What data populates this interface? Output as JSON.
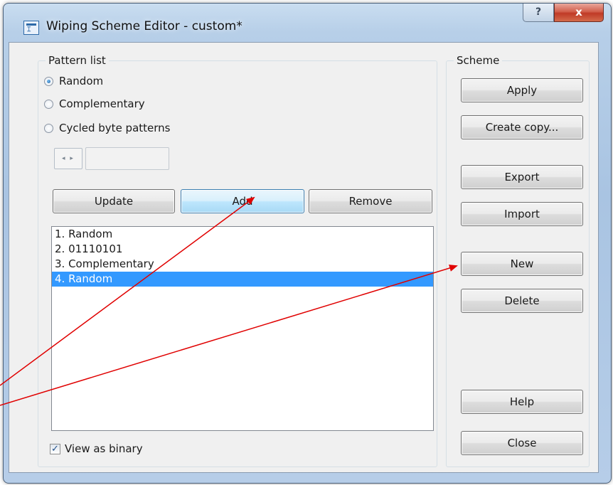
{
  "window": {
    "title": "Wiping Scheme Editor - custom*",
    "help_glyph": "?",
    "close_glyph": "x"
  },
  "pattern_group": {
    "label": "Pattern list",
    "radios": [
      {
        "label": "Random",
        "checked": true
      },
      {
        "label": "Complementary",
        "checked": false
      },
      {
        "label": "Cycled byte patterns",
        "checked": false
      }
    ],
    "spinner_glyph": "◂ ▸",
    "spin_value": "",
    "buttons": {
      "update": "Update",
      "add": "Add",
      "remove": "Remove"
    },
    "list_items": [
      {
        "label": "1. Random",
        "selected": false
      },
      {
        "label": "2. 01110101",
        "selected": false
      },
      {
        "label": "3. Complementary",
        "selected": false
      },
      {
        "label": "4. Random",
        "selected": true
      }
    ],
    "view_as_binary": {
      "label": "View as binary",
      "checked": true,
      "mark": "✓"
    }
  },
  "scheme_group": {
    "label": "Scheme",
    "buttons": {
      "apply": "Apply",
      "create_copy": "Create copy...",
      "export": "Export",
      "import": "Import",
      "new": "New",
      "delete": "Delete",
      "help": "Help",
      "close": "Close"
    }
  },
  "colors": {
    "selection": "#3399ff",
    "annotation_arrow": "#e00000",
    "close_button": "#c7402b"
  }
}
